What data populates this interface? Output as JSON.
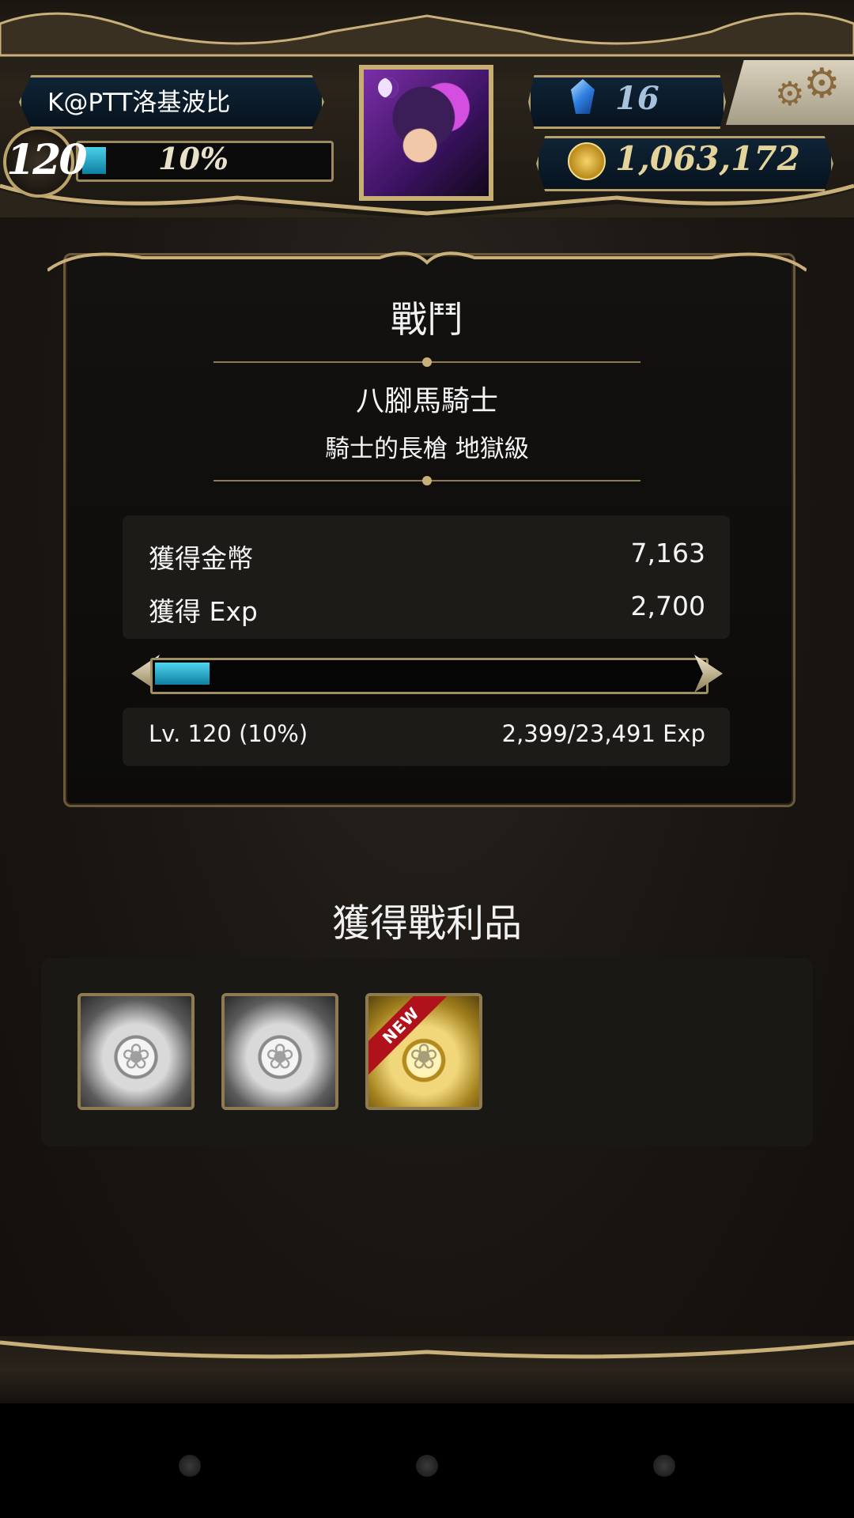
{
  "header": {
    "player_name": "K@PTT洛基波比",
    "level": "120",
    "xp_percent_label": "10%",
    "xp_fraction": 0.1,
    "gems": "16",
    "coins": "1,063,172",
    "icons": {
      "gem": "crystal-gem-icon",
      "coin": "gold-coin-icon",
      "settings": "gear-icon"
    }
  },
  "battle": {
    "title": "戰鬥",
    "enemy_name": "八腳馬騎士",
    "stage_name": "騎士的長槍 地獄級",
    "rewards": [
      {
        "label": "獲得金幣",
        "value": "7,163"
      },
      {
        "label": "獲得 Exp",
        "value": "2,700"
      }
    ],
    "exp_fraction": 0.1,
    "level_label": "Lv. 120 (10%)",
    "exp_progress": "2,399/23,491 Exp"
  },
  "loot": {
    "title": "獲得戰利品",
    "items": [
      {
        "type": "silver-card",
        "new": false
      },
      {
        "type": "silver-card",
        "new": false
      },
      {
        "type": "gold-card",
        "new": true,
        "badge": "NEW"
      }
    ]
  },
  "colors": {
    "accent_gold": "#b8a06a",
    "xp_cyan": "#4bd0ea",
    "new_ribbon": "#b0121b"
  }
}
